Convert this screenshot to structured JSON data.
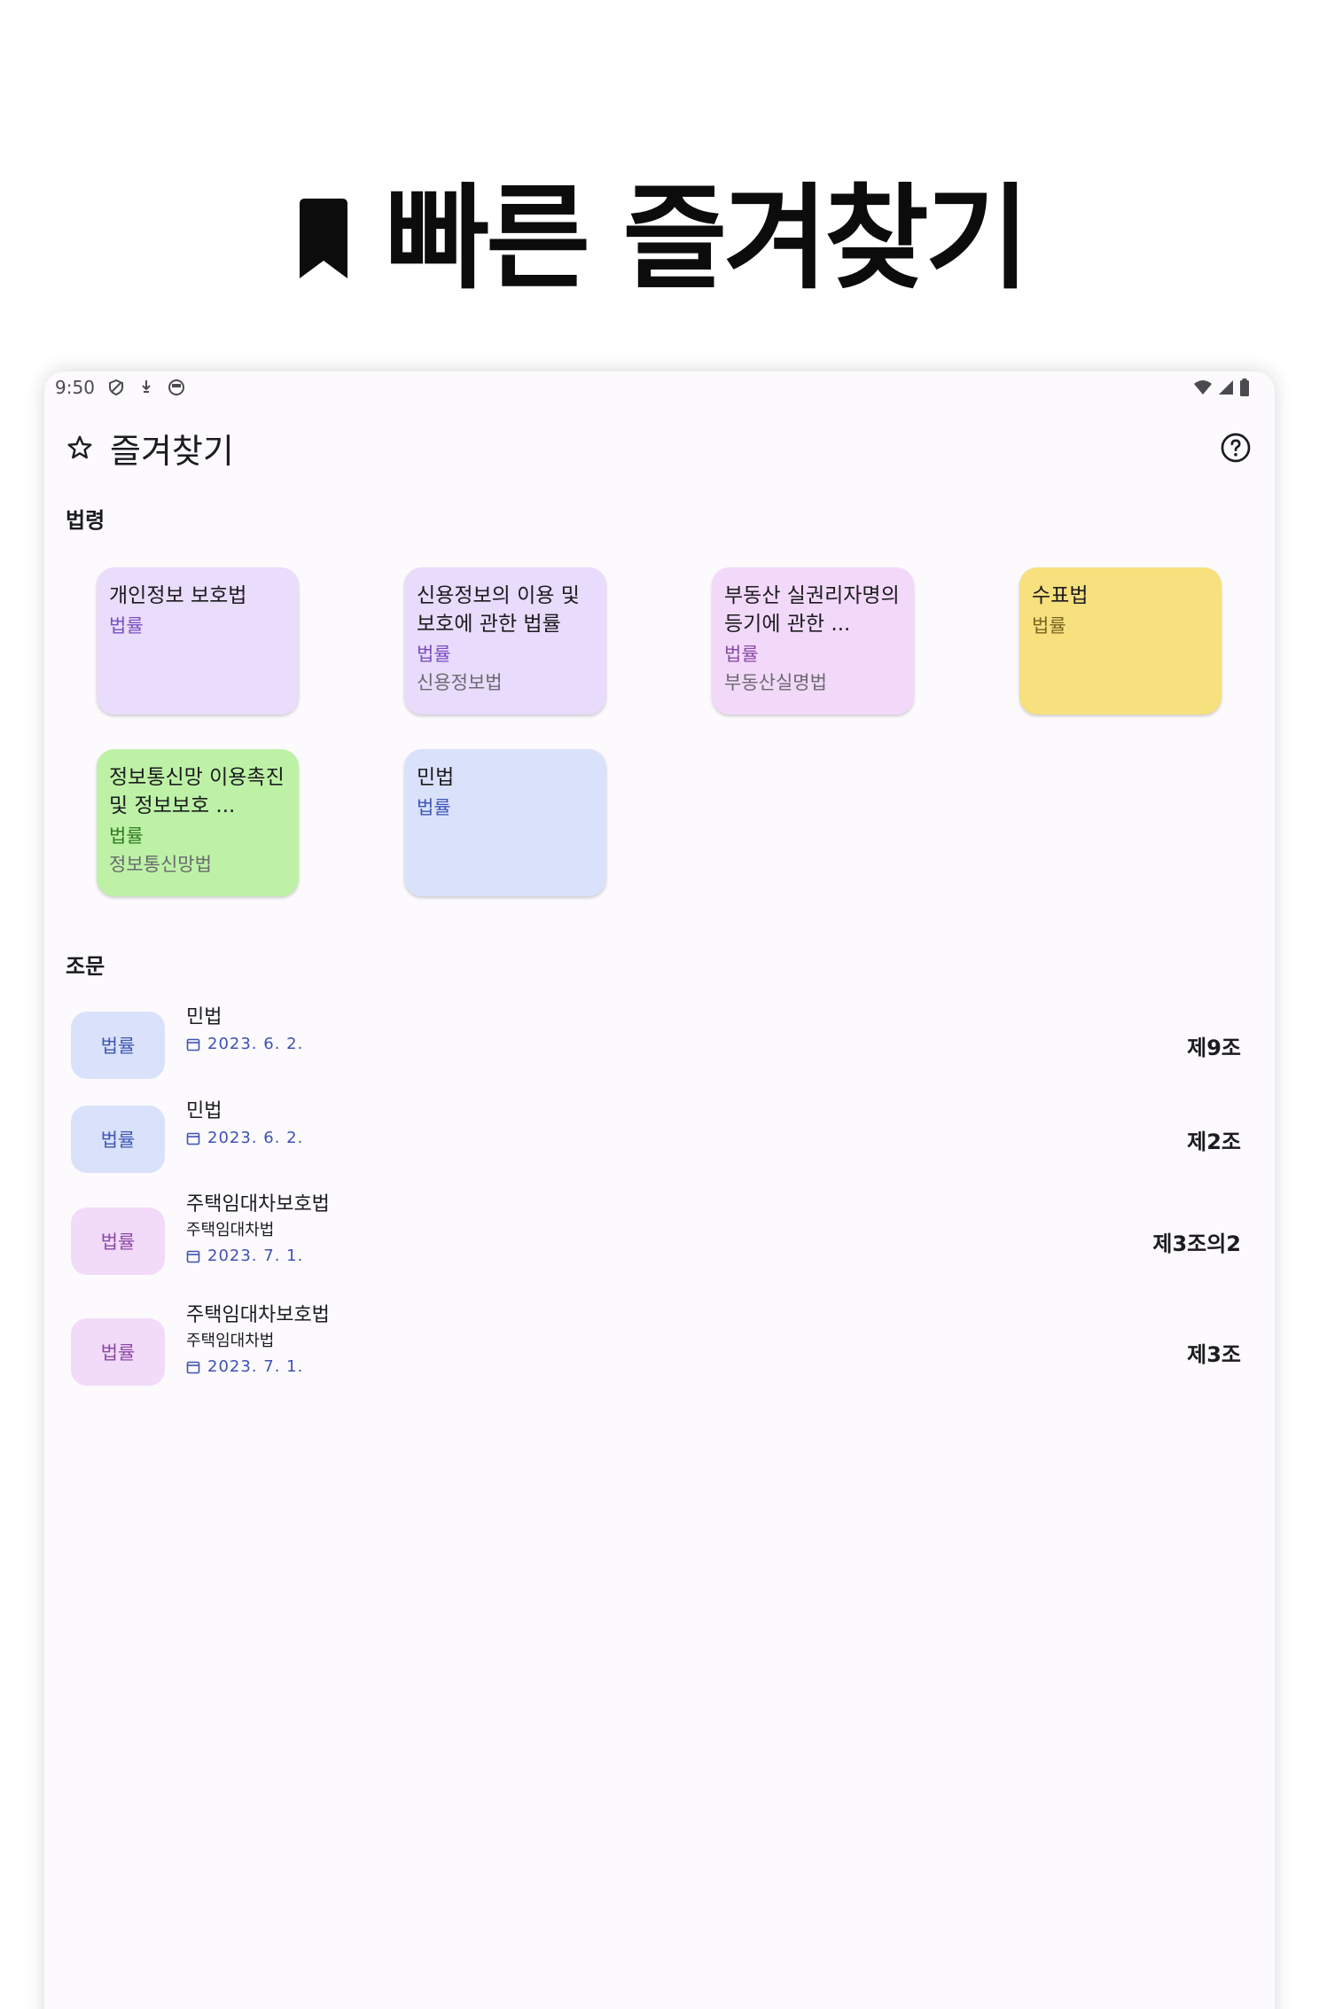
{
  "promo": {
    "title": "빠른 즐겨찾기",
    "icon": "bookmark-icon"
  },
  "statusbar": {
    "time": "9:50",
    "icons_left": [
      "shield-icon",
      "download-icon",
      "circle-app-icon"
    ],
    "icons_right": [
      "wifi-icon",
      "cell-signal-icon",
      "battery-icon"
    ]
  },
  "appbar": {
    "title": "즐겨찾기",
    "icon": "star-outline-icon",
    "help_icon": "help-circle-icon"
  },
  "sections": {
    "laws": "법령",
    "articles": "조문"
  },
  "laws": [
    {
      "name": "개인정보 보호법",
      "kind": "법률",
      "abbr": "",
      "bg": "#eadcfb",
      "kind_color": "#7a4fc0"
    },
    {
      "name": "신용정보의 이용 및 보호에 관한 법률",
      "kind": "법률",
      "abbr": "신용정보법",
      "bg": "#e8dbfb",
      "kind_color": "#7a4fc0"
    },
    {
      "name": "부동산 실권리자명의 등기에 관한 ...",
      "kind": "법률",
      "abbr": "부동산실명법",
      "bg": "#f2d9f9",
      "kind_color": "#8a4aa8"
    },
    {
      "name": "수표법",
      "kind": "법률",
      "abbr": "",
      "bg": "#f7e07e",
      "kind_color": "#7a6420"
    },
    {
      "name": "정보통신망 이용촉진 및 정보보호 ...",
      "kind": "법률",
      "abbr": "정보통신망법",
      "bg": "#bdf2a6",
      "kind_color": "#2f7a22"
    },
    {
      "name": "민법",
      "kind": "법률",
      "abbr": "",
      "bg": "#dae2fb",
      "kind_color": "#3f56b5"
    }
  ],
  "articles": [
    {
      "badge": "법률",
      "badge_bg": "#dae2fb",
      "badge_color": "#3f56b5",
      "name": "민법",
      "abbr": "",
      "date": "2023. 6. 2.",
      "article_no": "제9조"
    },
    {
      "badge": "법률",
      "badge_bg": "#dae2fb",
      "badge_color": "#3f56b5",
      "name": "민법",
      "abbr": "",
      "date": "2023. 6. 2.",
      "article_no": "제2조"
    },
    {
      "badge": "법률",
      "badge_bg": "#f2daf9",
      "badge_color": "#8a4aa8",
      "name": "주택임대차보호법",
      "abbr": "주택임대차법",
      "date": "2023. 7. 1.",
      "article_no": "제3조의2"
    },
    {
      "badge": "법률",
      "badge_bg": "#f2daf9",
      "badge_color": "#8a4aa8",
      "name": "주택임대차보호법",
      "abbr": "주택임대차법",
      "date": "2023. 7. 1.",
      "article_no": "제3조"
    }
  ]
}
